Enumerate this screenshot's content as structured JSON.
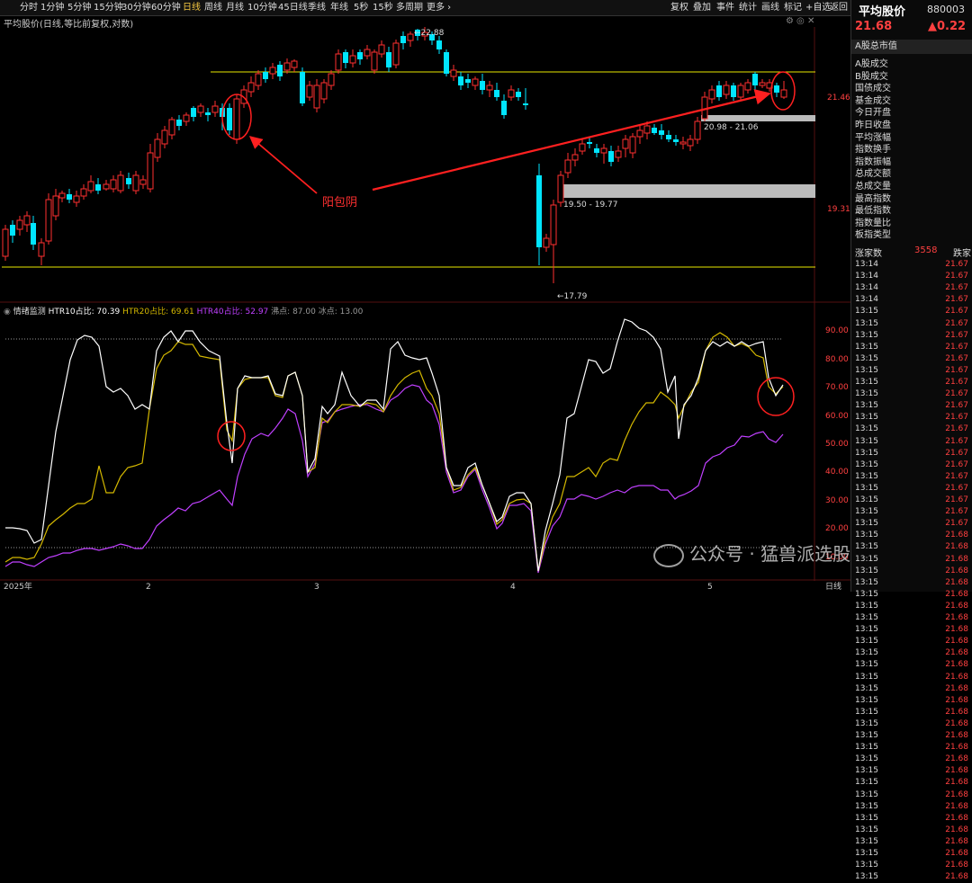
{
  "topbar": {
    "tabs": [
      "分时",
      "1分钟",
      "5分钟",
      "15分钟",
      "30分钟",
      "60分钟",
      "日线",
      "周线",
      "月线",
      "10分钟",
      "45日线",
      "季线",
      "年线",
      "5秒",
      "15秒",
      "多周期",
      "更多 ›"
    ],
    "active_tab": "日线",
    "right_tools": [
      "复权",
      "叠加",
      "事件",
      "统计",
      "画线",
      "标记",
      "+自选",
      "返回"
    ]
  },
  "chart_title": "平均股价(日线,等比前复权,对数)",
  "price_axis": [
    "21.46",
    "19.31"
  ],
  "price_labels": {
    "high": "22.88",
    "low": "17.79",
    "gap1": "20.98 - 21.06",
    "gap2": "19.50 - 19.77"
  },
  "annotation": "阳包阴",
  "x_axis": [
    "2025年",
    "2",
    "3",
    "4",
    "5",
    "日线"
  ],
  "indicator": {
    "name": "情绪监测",
    "htr10": "HTR10占比: 70.39",
    "htr20": "HTR20占比: 69.61",
    "htr40": "HTR40占比: 52.97",
    "boil": "沸点: 87.00",
    "ice": "冰点: 13.00",
    "axis": [
      "90.00",
      "80.00",
      "70.00",
      "60.00",
      "50.00",
      "40.00",
      "30.00",
      "20.00",
      "10.00"
    ]
  },
  "right_panel": {
    "title": "平均股价",
    "code": "880003",
    "price": "21.68",
    "change": "▲0.22",
    "header": "A股总市值",
    "items": [
      " A股成交",
      " B股成交",
      "国债成交",
      "基金成交",
      "今日开盘",
      "昨日收盘",
      "平均涨幅",
      "指数换手",
      "指数振幅",
      "总成交额",
      "总成交量",
      "最高指数",
      "最低指数",
      "指数量比",
      "板指类型"
    ],
    "up_label": "涨家数",
    "up_count": "3558",
    "down_label": "跌家",
    "ticks": [
      {
        "t": "13:14",
        "v": "21.67"
      },
      {
        "t": "13:14",
        "v": "21.67"
      },
      {
        "t": "13:14",
        "v": "21.67"
      },
      {
        "t": "13:14",
        "v": "21.67"
      },
      {
        "t": "13:15",
        "v": "21.67"
      },
      {
        "t": "13:15",
        "v": "21.67"
      },
      {
        "t": "13:15",
        "v": "21.67"
      },
      {
        "t": "13:15",
        "v": "21.67"
      },
      {
        "t": "13:15",
        "v": "21.67"
      },
      {
        "t": "13:15",
        "v": "21.67"
      },
      {
        "t": "13:15",
        "v": "21.67"
      },
      {
        "t": "13:15",
        "v": "21.67"
      },
      {
        "t": "13:15",
        "v": "21.67"
      },
      {
        "t": "13:15",
        "v": "21.67"
      },
      {
        "t": "13:15",
        "v": "21.67"
      },
      {
        "t": "13:15",
        "v": "21.67"
      },
      {
        "t": "13:15",
        "v": "21.67"
      },
      {
        "t": "13:15",
        "v": "21.67"
      },
      {
        "t": "13:15",
        "v": "21.67"
      },
      {
        "t": "13:15",
        "v": "21.67"
      },
      {
        "t": "13:15",
        "v": "21.67"
      },
      {
        "t": "13:15",
        "v": "21.67"
      },
      {
        "t": "13:15",
        "v": "21.67"
      },
      {
        "t": "13:15",
        "v": "21.68"
      },
      {
        "t": "13:15",
        "v": "21.68"
      },
      {
        "t": "13:15",
        "v": "21.68"
      },
      {
        "t": "13:15",
        "v": "21.68"
      },
      {
        "t": "13:15",
        "v": "21.68"
      },
      {
        "t": "13:15",
        "v": "21.68"
      },
      {
        "t": "13:15",
        "v": "21.68"
      },
      {
        "t": "13:15",
        "v": "21.68"
      },
      {
        "t": "13:15",
        "v": "21.68"
      },
      {
        "t": "13:15",
        "v": "21.68"
      },
      {
        "t": "13:15",
        "v": "21.68"
      },
      {
        "t": "13:15",
        "v": "21.68"
      },
      {
        "t": "13:15",
        "v": "21.68"
      },
      {
        "t": "13:15",
        "v": "21.68"
      },
      {
        "t": "13:15",
        "v": "21.68"
      },
      {
        "t": "13:15",
        "v": "21.68"
      },
      {
        "t": "13:15",
        "v": "21.68"
      },
      {
        "t": "13:15",
        "v": "21.68"
      },
      {
        "t": "13:15",
        "v": "21.68"
      },
      {
        "t": "13:15",
        "v": "21.68"
      },
      {
        "t": "13:15",
        "v": "21.68"
      },
      {
        "t": "13:15",
        "v": "21.68"
      },
      {
        "t": "13:15",
        "v": "21.68"
      },
      {
        "t": "13:15",
        "v": "21.68"
      },
      {
        "t": "13:15",
        "v": "21.68"
      },
      {
        "t": "13:15",
        "v": "21.68"
      },
      {
        "t": "13:15",
        "v": "21.68"
      },
      {
        "t": "13:15",
        "v": "21.68"
      },
      {
        "t": "13:15",
        "v": "21.68"
      },
      {
        "t": "13:15",
        "v": "21.68"
      }
    ]
  },
  "watermark": "公众号 · 猛兽派选股",
  "colors": {
    "up": "#ff3030",
    "down": "#00e5ff",
    "yellow": "#e8e800",
    "htr10": "#ffffff",
    "htr20": "#d4b800",
    "htr40": "#c040ff"
  }
}
